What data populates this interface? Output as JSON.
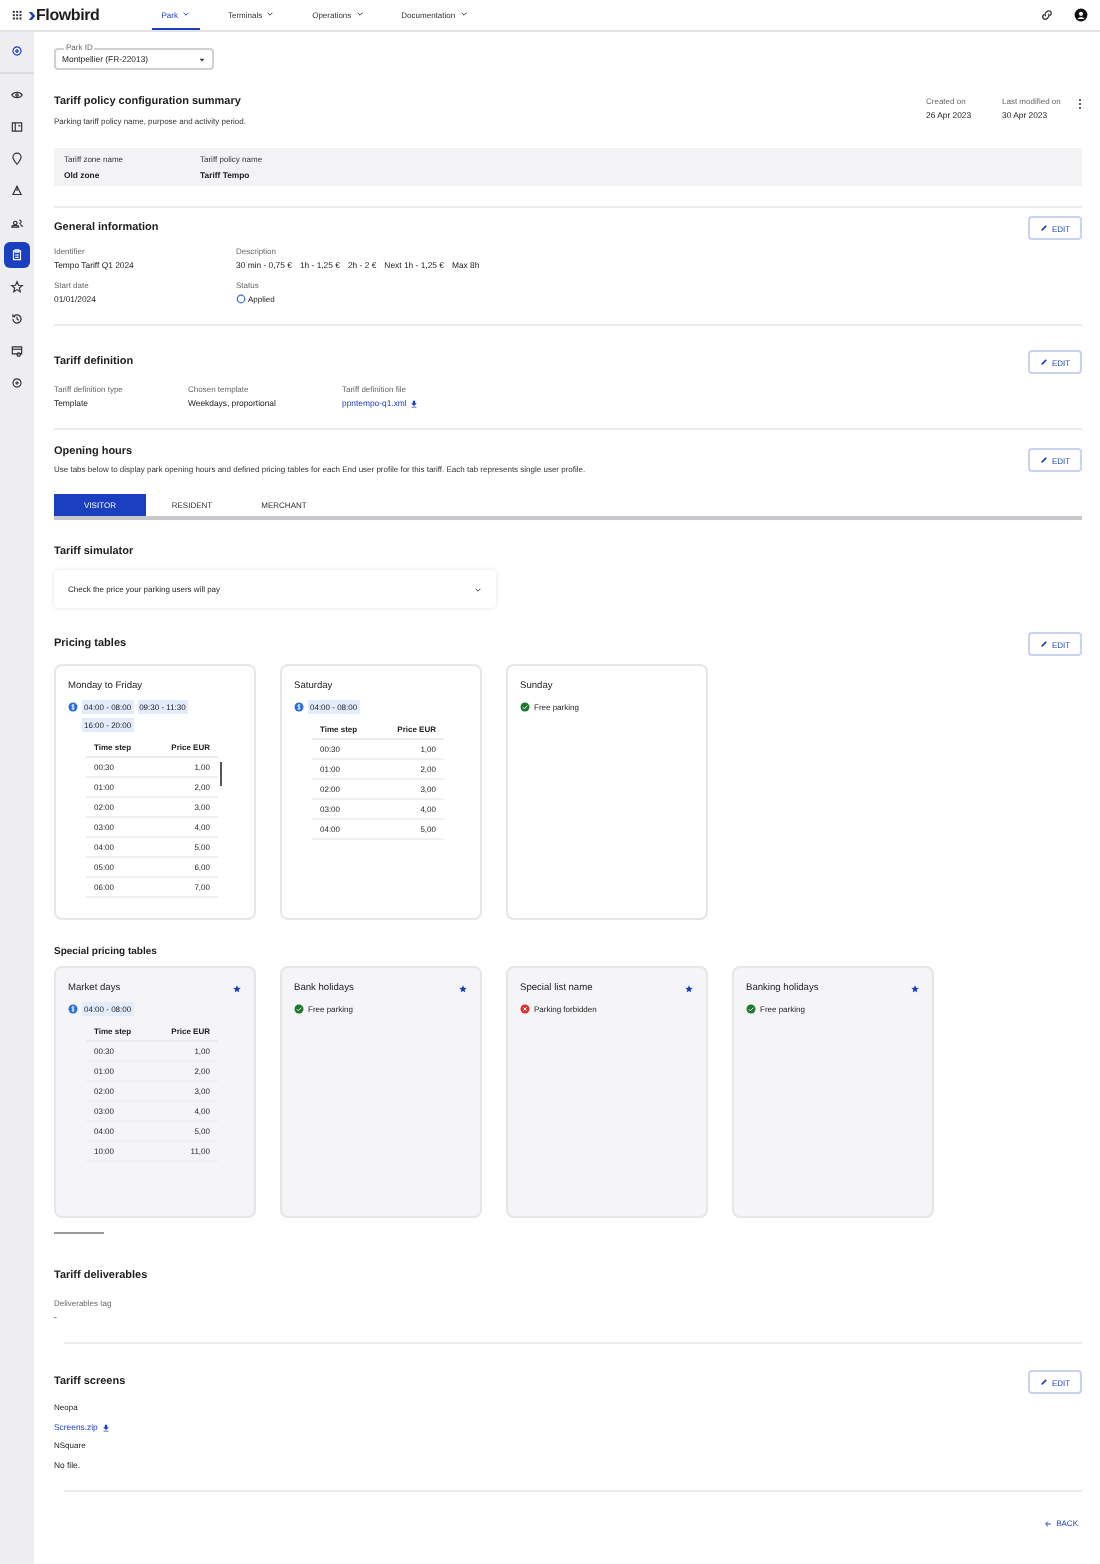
{
  "nav": {
    "logo": "Flowbird",
    "items": [
      {
        "label": "Park",
        "selected": true
      },
      {
        "label": "Terminals",
        "selected": false
      },
      {
        "label": "Operations",
        "selected": false
      },
      {
        "label": "Documentation",
        "selected": false
      }
    ]
  },
  "sidebar": {
    "items": [
      {
        "selected": false
      },
      {
        "selected": false
      },
      {
        "selected": false
      },
      {
        "selected": false
      },
      {
        "selected": false
      },
      {
        "selected": false
      },
      {
        "selected": true
      },
      {
        "selected": false
      },
      {
        "selected": false
      },
      {
        "selected": false
      },
      {
        "selected": false
      }
    ]
  },
  "park_field": {
    "label": "Park ID",
    "value": "Montpellier (FR-22013)"
  },
  "summary": {
    "title": "Tariff policy configuration summary",
    "subtitle": "Parking tariff policy name, purpose and activity period.",
    "meta": [
      {
        "label": "Created on",
        "value": "26 Apr 2023"
      },
      {
        "label": "Last modified on",
        "value": "30 Apr 2023"
      }
    ],
    "fields": [
      {
        "label": "Tariff zone name",
        "value": "Old zone"
      },
      {
        "label": "Tariff policy name",
        "value": "Tariff Tempo"
      }
    ]
  },
  "general": {
    "title": "General information",
    "edit": "EDIT",
    "identifier": {
      "label": "Identifier",
      "value": "Tempo Tariff Q1 2024"
    },
    "description": {
      "label": "Description",
      "items": [
        "30 min - 0,75 €",
        "1h - 1,25 €",
        "2h - 2 €",
        "Next 1h - 1,25 €",
        "Max 8h"
      ]
    },
    "start_date": {
      "label": "Start date",
      "value": "01/01/2024"
    },
    "status": {
      "label": "Status",
      "value": "Applied"
    }
  },
  "definition": {
    "title": "Tariff definition",
    "edit": "EDIT",
    "fields": [
      {
        "label": "Tariff definition type",
        "value": "Template",
        "kind": "text"
      },
      {
        "label": "Chosen template",
        "value": "Weekdays, proportional",
        "kind": "text"
      },
      {
        "label": "Tariff definition file",
        "value": "ppntempo-q1.xml",
        "kind": "file"
      }
    ]
  },
  "opening_hours": {
    "title": "Opening hours",
    "edit": "EDIT",
    "description": "Use tabs below to display park opening hours and defined pricing tables for each End user profile for this tariff. Each tab represents single user profile.",
    "tabs": [
      {
        "label": "VISITOR",
        "selected": true
      },
      {
        "label": "RESIDENT",
        "selected": false
      },
      {
        "label": "MERCHANT",
        "selected": false
      }
    ]
  },
  "simulator": {
    "title": "Tariff simulator",
    "label": "Check the price your parking users will pay"
  },
  "pricing": {
    "title": "Pricing tables",
    "edit": "EDIT",
    "cards": [
      {
        "title": "Monday to Friday",
        "kind": "table",
        "scrollable": true,
        "slots": [
          "04:00 - 08:00",
          "09:30 - 11:30",
          "16:00 - 20:00"
        ],
        "columns": [
          "Time step",
          "Price EUR"
        ],
        "rows": [
          [
            "00:30",
            "1,00"
          ],
          [
            "01:00",
            "2,00"
          ],
          [
            "02:00",
            "3,00"
          ],
          [
            "03:00",
            "4,00"
          ],
          [
            "04:00",
            "5,00"
          ],
          [
            "05:00",
            "6,00"
          ],
          [
            "06:00",
            "7,00"
          ]
        ]
      },
      {
        "title": "Saturday",
        "kind": "table",
        "scrollable": false,
        "slots": [
          "04:00 - 08:00"
        ],
        "columns": [
          "Time step",
          "Price EUR"
        ],
        "rows": [
          [
            "00:30",
            "1,00"
          ],
          [
            "01:00",
            "2,00"
          ],
          [
            "02:00",
            "3,00"
          ],
          [
            "03:00",
            "4,00"
          ],
          [
            "04:00",
            "5,00"
          ]
        ]
      },
      {
        "title": "Sunday",
        "kind": "free",
        "text": "Free parking"
      }
    ]
  },
  "special": {
    "title": "Special pricing tables",
    "cards": [
      {
        "title": "Market days",
        "kind": "table",
        "scrollable": false,
        "slots": [
          "04:00 - 08:00"
        ],
        "columns": [
          "Time step",
          "Price EUR"
        ],
        "rows": [
          [
            "00:30",
            "1,00"
          ],
          [
            "01:00",
            "2,00"
          ],
          [
            "02:00",
            "3,00"
          ],
          [
            "03:00",
            "4,00"
          ],
          [
            "04:00",
            "5,00"
          ],
          [
            "10:00",
            "11,00"
          ]
        ]
      },
      {
        "title": "Bank holidays",
        "kind": "free",
        "text": "Free parking"
      },
      {
        "title": "Special list name",
        "kind": "forbidden",
        "text": "Parking forbidden"
      },
      {
        "title": "Banking holidays",
        "kind": "free",
        "text": "Free parking"
      }
    ]
  },
  "deliverables": {
    "title": "Tariff deliverables",
    "label": "Deliverables tag",
    "value": "-"
  },
  "screens": {
    "title": "Tariff screens",
    "edit": "EDIT",
    "items": [
      {
        "name": "Neopa",
        "file": "Screens.zip",
        "kind": "file"
      },
      {
        "name": "NSquare",
        "file": "No file.",
        "kind": "none"
      }
    ]
  },
  "back": "BACK"
}
